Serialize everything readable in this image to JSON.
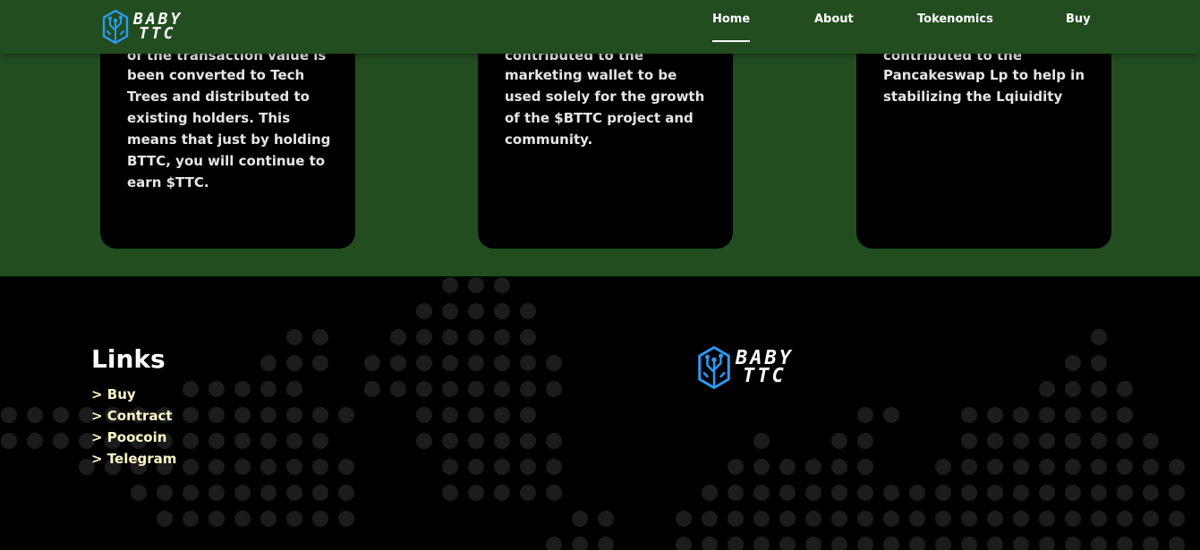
{
  "brand": {
    "line1": "BABY",
    "line2": "TTC"
  },
  "nav": [
    {
      "label": "Home",
      "active": true
    },
    {
      "label": "About",
      "active": false
    },
    {
      "label": "Tokenomics",
      "active": false
    },
    {
      "label": "Buy",
      "active": false
    }
  ],
  "cards": [
    {
      "partial_line": "of the transaction value is",
      "text": "been converted to Tech Trees and distributed to existing holders. This means that just by holding BTTC, you will continue to earn $TTC."
    },
    {
      "partial_line": "contributed to the",
      "text": "marketing wallet to be used solely for the growth of the $BTTC project and community."
    },
    {
      "partial_line": "contributed to the",
      "text": "Pancakeswap Lp to help in stabilizing the Lqiuidity"
    }
  ],
  "footer": {
    "links_title": "Links",
    "links": [
      "> Buy",
      "> Contract",
      "> Poocoin",
      "> Telegram"
    ]
  },
  "colors": {
    "header_bg": "#214d1f",
    "footer_bg": "#000000",
    "link_color": "#fff6c8",
    "logo_blue": "#2b9bf4",
    "dot_color": "#1c1c1c"
  }
}
